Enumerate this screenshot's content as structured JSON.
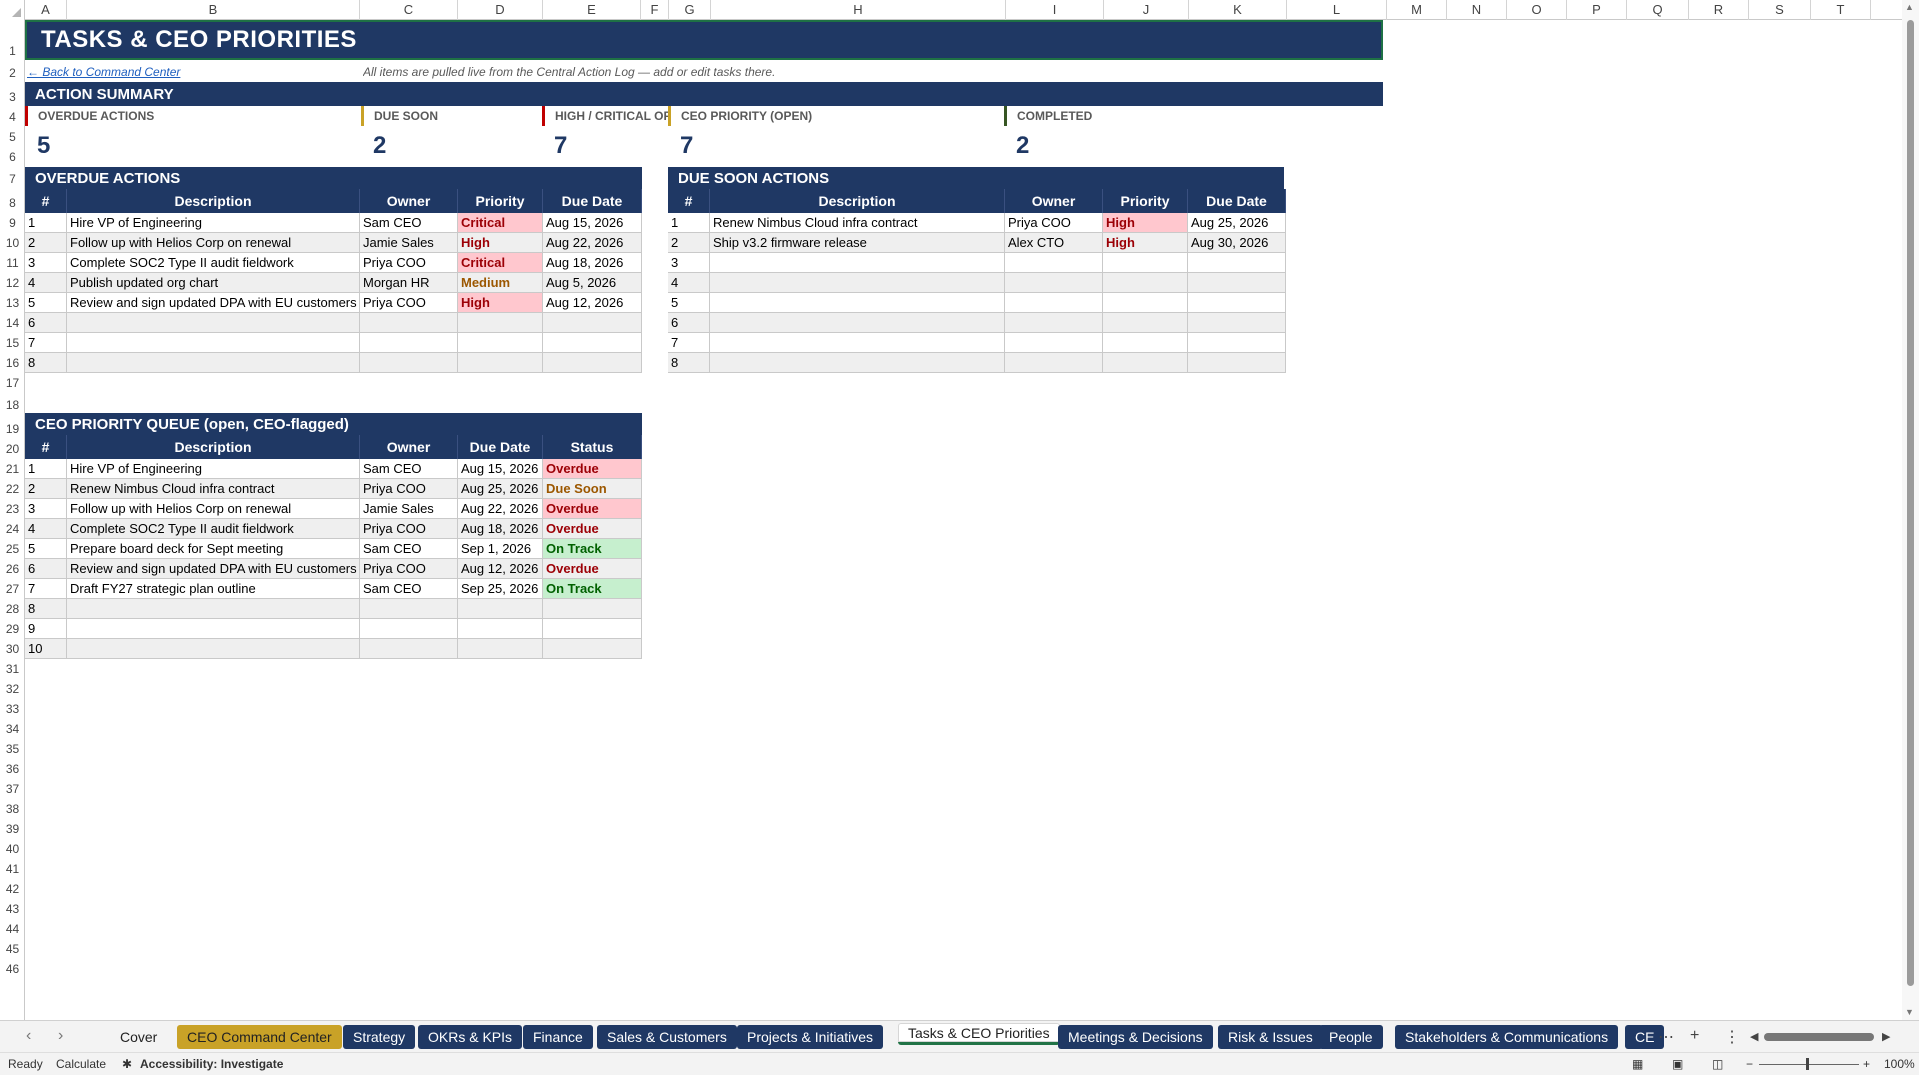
{
  "columns": [
    "A",
    "B",
    "C",
    "D",
    "E",
    "F",
    "G",
    "H",
    "I",
    "J",
    "K",
    "L",
    "M",
    "N",
    "O",
    "P",
    "Q",
    "R",
    "S",
    "T"
  ],
  "rows": [
    "1",
    "2",
    "3",
    "4",
    "5",
    "6",
    "7",
    "8",
    "9",
    "10",
    "11",
    "12",
    "13",
    "14",
    "15",
    "16",
    "17",
    "18",
    "19",
    "20",
    "21",
    "22",
    "23",
    "24",
    "25",
    "26",
    "27",
    "28",
    "29",
    "30",
    "31",
    "32",
    "33",
    "34",
    "35",
    "36",
    "37",
    "38",
    "39",
    "40",
    "41",
    "42",
    "43",
    "44",
    "45",
    "46"
  ],
  "sheet": {
    "title": "TASKS  &  CEO PRIORITIES",
    "back_link": "← Back to Command Center",
    "note": "All items are pulled live from the Central Action Log — add or edit tasks there.",
    "summary_title": "ACTION SUMMARY",
    "kpis": [
      {
        "label": "OVERDUE ACTIONS",
        "value": "5",
        "color": "#c00000"
      },
      {
        "label": "DUE SOON",
        "value": "2",
        "color": "#c9a227"
      },
      {
        "label": "HIGH / CRITICAL OPEN",
        "value": "7",
        "color": "#c00000"
      },
      {
        "label": "CEO PRIORITY (OPEN)",
        "value": "7",
        "color": "#c9a227"
      },
      {
        "label": "COMPLETED",
        "value": "2",
        "color": "#375623"
      }
    ]
  },
  "overdue": {
    "title": "OVERDUE ACTIONS",
    "headers": [
      "#",
      "Description",
      "Owner",
      "Priority",
      "Due Date"
    ],
    "rows": [
      {
        "num": "1",
        "desc": "Hire VP of Engineering",
        "owner": "Sam CEO",
        "priority": "Critical",
        "due": "Aug 15, 2026"
      },
      {
        "num": "2",
        "desc": "Follow up with Helios Corp on renewal",
        "owner": "Jamie Sales",
        "priority": "High",
        "due": "Aug 22, 2026"
      },
      {
        "num": "3",
        "desc": "Complete SOC2 Type II audit fieldwork",
        "owner": "Priya COO",
        "priority": "Critical",
        "due": "Aug 18, 2026"
      },
      {
        "num": "4",
        "desc": "Publish updated org chart",
        "owner": "Morgan HR",
        "priority": "Medium",
        "due": "Aug 5, 2026"
      },
      {
        "num": "5",
        "desc": "Review and sign updated DPA with EU customers",
        "owner": "Priya COO",
        "priority": "High",
        "due": "Aug 12, 2026"
      },
      {
        "num": "6",
        "desc": "",
        "owner": "",
        "priority": "",
        "due": ""
      },
      {
        "num": "7",
        "desc": "",
        "owner": "",
        "priority": "",
        "due": ""
      },
      {
        "num": "8",
        "desc": "",
        "owner": "",
        "priority": "",
        "due": ""
      }
    ]
  },
  "due_soon": {
    "title": "DUE SOON ACTIONS",
    "headers": [
      "#",
      "Description",
      "Owner",
      "Priority",
      "Due Date"
    ],
    "rows": [
      {
        "num": "1",
        "desc": "Renew Nimbus Cloud infra contract",
        "owner": "Priya COO",
        "priority": "High",
        "due": "Aug 25, 2026"
      },
      {
        "num": "2",
        "desc": "Ship v3.2 firmware release",
        "owner": "Alex CTO",
        "priority": "High",
        "due": "Aug 30, 2026"
      },
      {
        "num": "3",
        "desc": "",
        "owner": "",
        "priority": "",
        "due": ""
      },
      {
        "num": "4",
        "desc": "",
        "owner": "",
        "priority": "",
        "due": ""
      },
      {
        "num": "5",
        "desc": "",
        "owner": "",
        "priority": "",
        "due": ""
      },
      {
        "num": "6",
        "desc": "",
        "owner": "",
        "priority": "",
        "due": ""
      },
      {
        "num": "7",
        "desc": "",
        "owner": "",
        "priority": "",
        "due": ""
      },
      {
        "num": "8",
        "desc": "",
        "owner": "",
        "priority": "",
        "due": ""
      }
    ]
  },
  "ceo_queue": {
    "title": "CEO PRIORITY QUEUE (open, CEO-flagged)",
    "headers": [
      "#",
      "Description",
      "Owner",
      "Due Date",
      "Status"
    ],
    "rows": [
      {
        "num": "1",
        "desc": "Hire VP of Engineering",
        "owner": "Sam CEO",
        "due": "Aug 15, 2026",
        "status": "Overdue"
      },
      {
        "num": "2",
        "desc": "Renew Nimbus Cloud infra contract",
        "owner": "Priya COO",
        "due": "Aug 25, 2026",
        "status": "Due Soon"
      },
      {
        "num": "3",
        "desc": "Follow up with Helios Corp on renewal",
        "owner": "Jamie Sales",
        "due": "Aug 22, 2026",
        "status": "Overdue"
      },
      {
        "num": "4",
        "desc": "Complete SOC2 Type II audit fieldwork",
        "owner": "Priya COO",
        "due": "Aug 18, 2026",
        "status": "Overdue"
      },
      {
        "num": "5",
        "desc": "Prepare board deck for Sept meeting",
        "owner": "Sam CEO",
        "due": "Sep 1, 2026",
        "status": "On Track"
      },
      {
        "num": "6",
        "desc": "Review and sign updated DPA with EU customers",
        "owner": "Priya COO",
        "due": "Aug 12, 2026",
        "status": "Overdue"
      },
      {
        "num": "7",
        "desc": "Draft FY27 strategic plan outline",
        "owner": "Sam CEO",
        "due": "Sep 25, 2026",
        "status": "On Track"
      },
      {
        "num": "8",
        "desc": "",
        "owner": "",
        "due": "",
        "status": ""
      },
      {
        "num": "9",
        "desc": "",
        "owner": "",
        "due": "",
        "status": ""
      },
      {
        "num": "10",
        "desc": "",
        "owner": "",
        "due": "",
        "status": ""
      }
    ]
  },
  "tabs": [
    {
      "label": "Cover",
      "style": "plain"
    },
    {
      "label": "CEO Command Center",
      "style": "gold"
    },
    {
      "label": "Strategy",
      "style": "navy"
    },
    {
      "label": "OKRs & KPIs",
      "style": "navy"
    },
    {
      "label": "Finance",
      "style": "navy"
    },
    {
      "label": "Sales & Customers",
      "style": "navy"
    },
    {
      "label": "Projects & Initiatives",
      "style": "navy"
    },
    {
      "label": "Tasks & CEO Priorities",
      "style": "active"
    },
    {
      "label": "Meetings & Decisions",
      "style": "navy"
    },
    {
      "label": "Risk & Issues",
      "style": "navy"
    },
    {
      "label": "People",
      "style": "navy"
    },
    {
      "label": "Stakeholders & Communications",
      "style": "navy"
    },
    {
      "label": "CE",
      "style": "navy"
    }
  ],
  "status": {
    "ready": "Ready",
    "calculate": "Calculate",
    "accessibility": "Accessibility: Investigate",
    "zoom": "100%"
  }
}
